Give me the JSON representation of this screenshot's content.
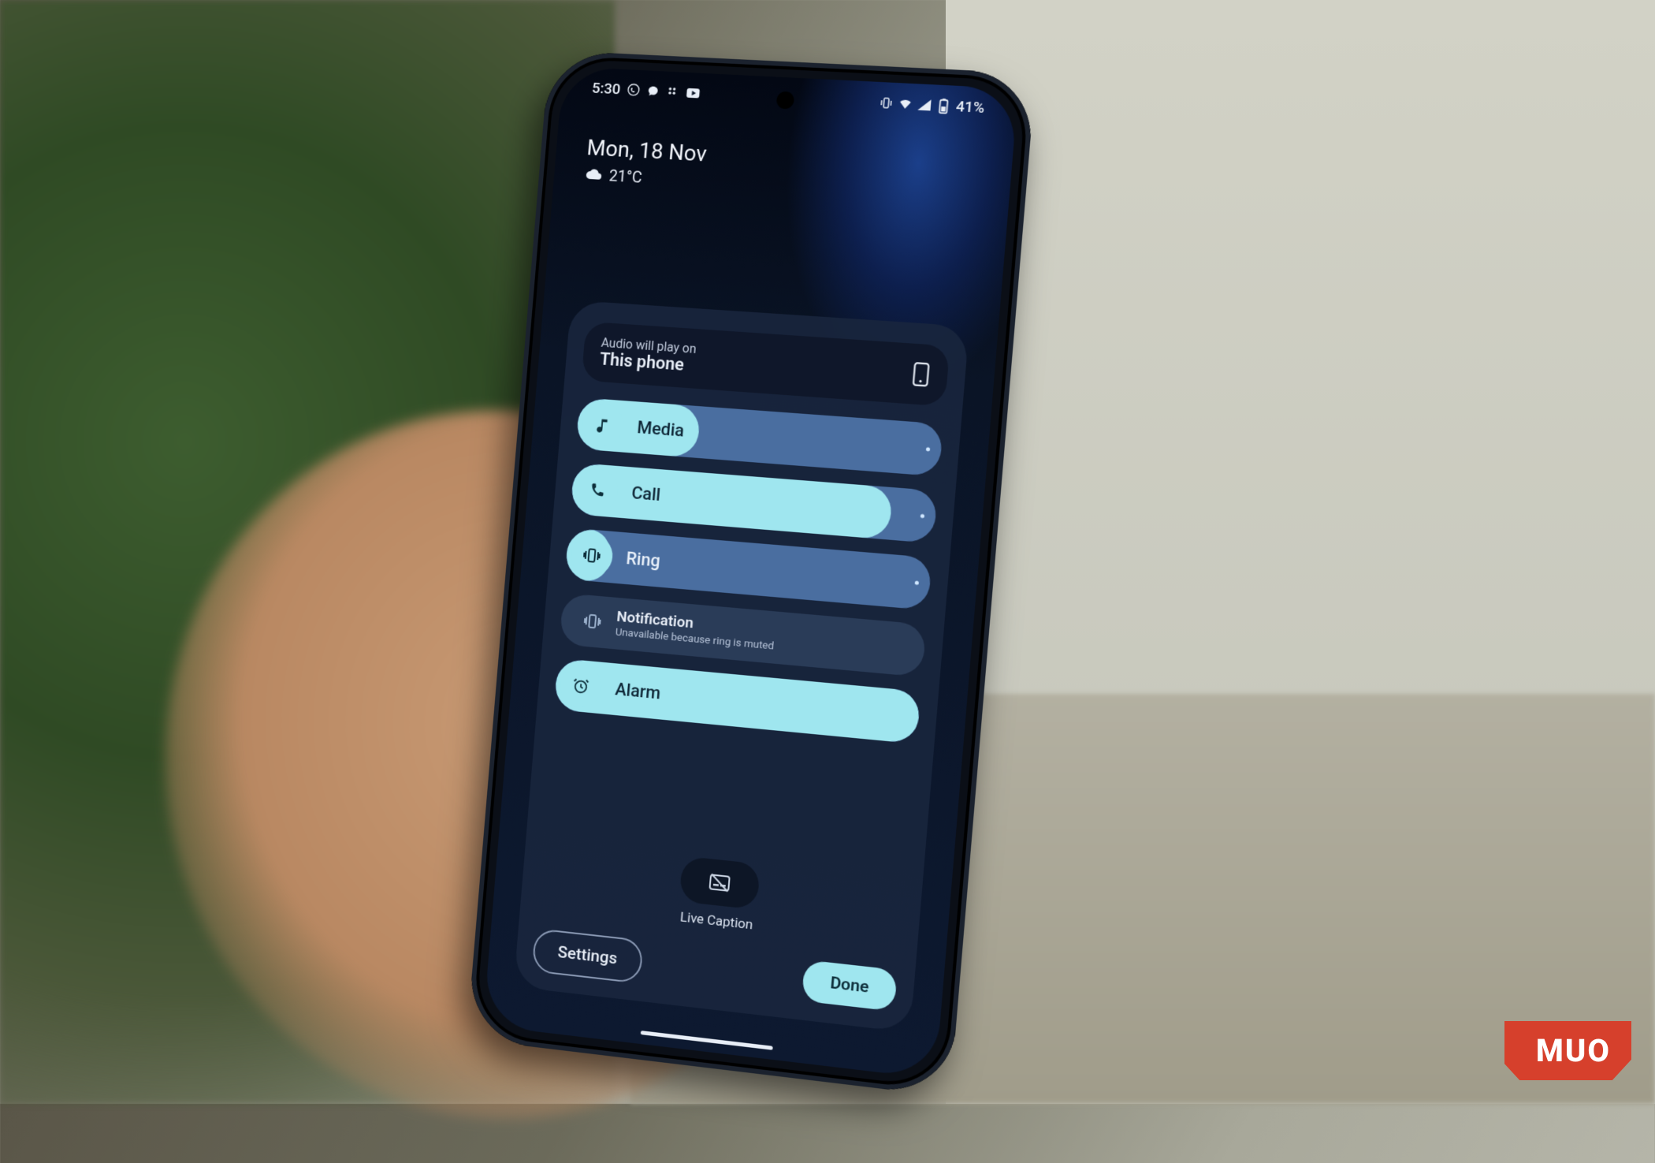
{
  "status_bar": {
    "time": "5:30",
    "battery_text": "41%"
  },
  "home": {
    "date": "Mon, 18 Nov",
    "temp": "21°C"
  },
  "output": {
    "hint": "Audio will play on",
    "device": "This phone"
  },
  "sliders": {
    "media": {
      "label": "Media",
      "fill_pct": 34
    },
    "call": {
      "label": "Call",
      "fill_pct": 88
    },
    "ring": {
      "label": "Ring",
      "fill_pct": 11
    },
    "notification": {
      "label": "Notification",
      "sub": "Unavailable because ring is muted"
    },
    "alarm": {
      "label": "Alarm",
      "fill_pct": 100
    }
  },
  "caption": {
    "label": "Live Caption"
  },
  "buttons": {
    "settings": "Settings",
    "done": "Done"
  },
  "watermark": "MUO"
}
